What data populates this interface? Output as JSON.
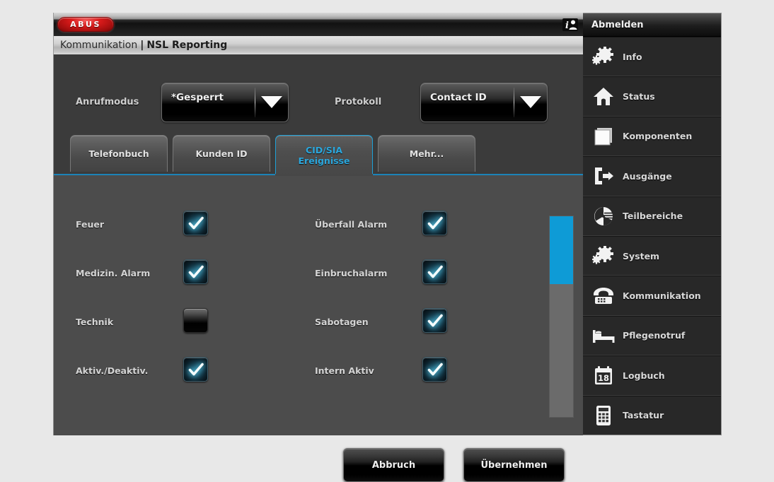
{
  "brand": {
    "logo_text": "ABUS"
  },
  "topbar": {
    "user_icon": "info-user-icon"
  },
  "breadcrumb": {
    "parent": "Kommunikation",
    "separator": "|",
    "current": "NSL Reporting"
  },
  "fields": [
    {
      "label": "Anrufmodus",
      "value": "*Gesperrt",
      "icon": "chevron-down-icon"
    },
    {
      "label": "Protokoll",
      "value": "Contact ID",
      "icon": "chevron-down-icon"
    }
  ],
  "tabs": [
    {
      "label": "Telefonbuch",
      "active": false
    },
    {
      "label": "Kunden ID",
      "active": false
    },
    {
      "label": "CID/SIA\nEreignisse",
      "active": true
    },
    {
      "label": "Mehr...",
      "active": false
    }
  ],
  "checkbox_left": [
    {
      "label": "Feuer",
      "checked": true
    },
    {
      "label": "Medizin. Alarm",
      "checked": true
    },
    {
      "label": "Technik",
      "checked": false
    },
    {
      "label": "Aktiv./Deaktiv.",
      "checked": true
    }
  ],
  "checkbox_right": [
    {
      "label": "Überfall Alarm",
      "checked": true
    },
    {
      "label": "Einbruchalarm",
      "checked": true
    },
    {
      "label": "Sabotagen",
      "checked": true
    },
    {
      "label": "Intern Aktiv",
      "checked": true
    }
  ],
  "scrollbar": {
    "thumb_color": "#0e9bd6",
    "track_color": "#6b6b6b",
    "position_percent": 0
  },
  "buttons": {
    "cancel": "Abbruch",
    "apply": "Übernehmen"
  },
  "sidebar": {
    "logout": "Abmelden",
    "items": [
      {
        "label": "Info",
        "icon": "gears-icon"
      },
      {
        "label": "Status",
        "icon": "house-icon"
      },
      {
        "label": "Komponenten",
        "icon": "cube-icon"
      },
      {
        "label": "Ausgänge",
        "icon": "exit-arrow-icon"
      },
      {
        "label": "Teilbereiche",
        "icon": "pie-chart-icon"
      },
      {
        "label": "System",
        "icon": "gears-icon"
      },
      {
        "label": "Kommunikation",
        "icon": "telephone-icon"
      },
      {
        "label": "Pflegenotruf",
        "icon": "bed-icon"
      },
      {
        "label": "Logbuch",
        "icon": "calendar-icon",
        "badge": "18"
      },
      {
        "label": "Tastatur",
        "icon": "keypad-icon"
      }
    ]
  },
  "colors": {
    "accent_blue": "#0e9bd6",
    "tab_active_text": "#2ba7dd",
    "brand_red": "#d81a1a",
    "panel_bg": "#4c4c4c"
  }
}
